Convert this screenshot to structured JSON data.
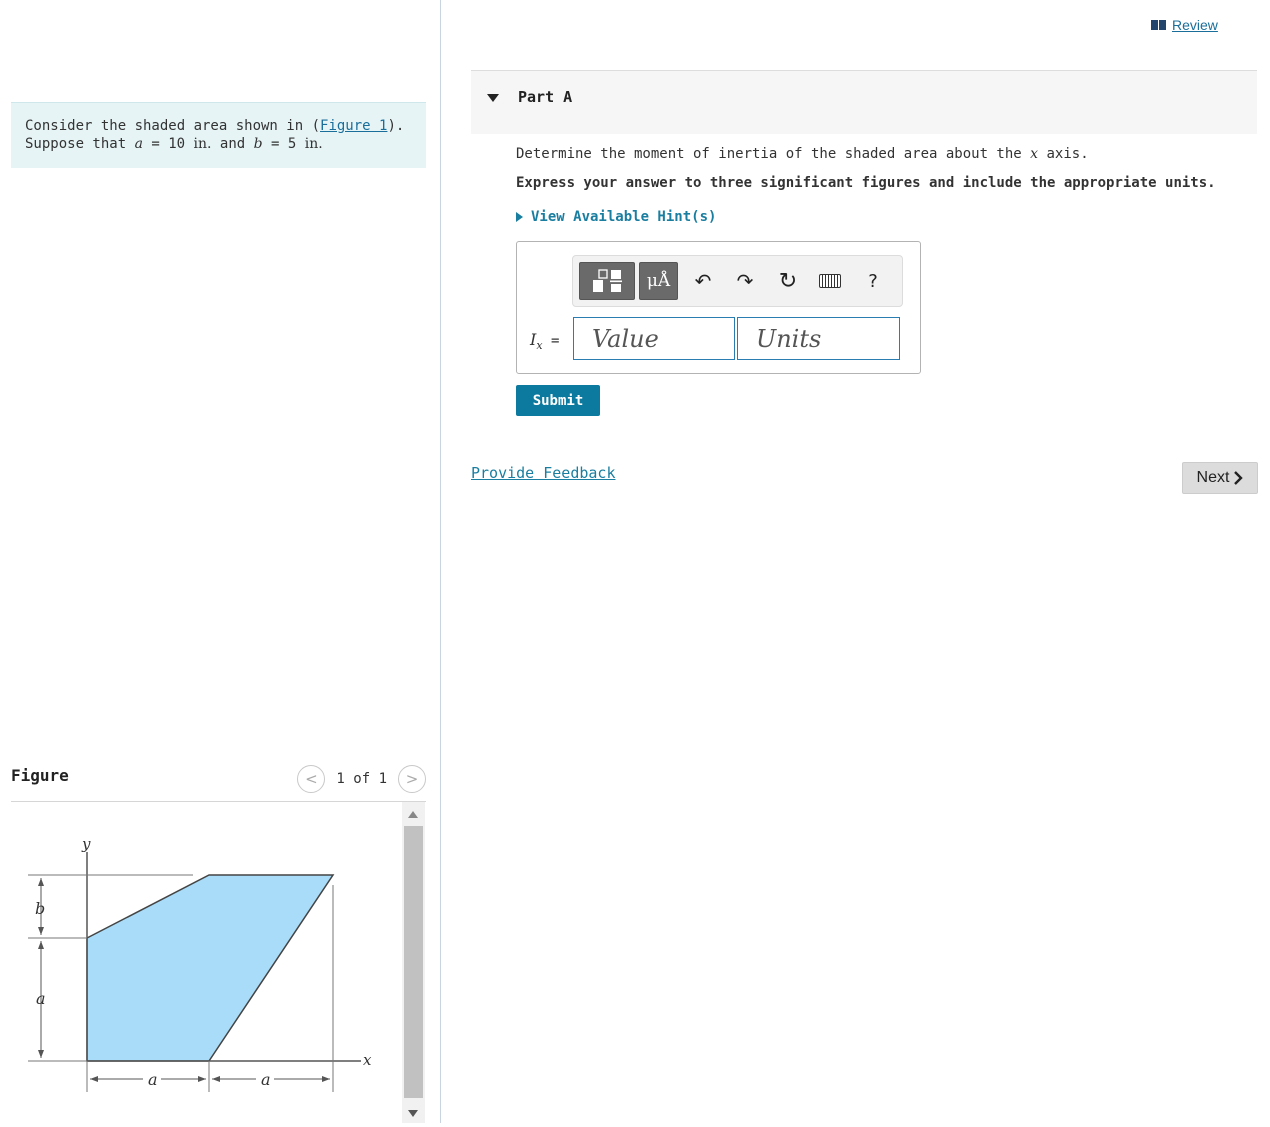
{
  "header": {
    "review_label": "Review"
  },
  "problem": {
    "line1_prefix": "Consider the shaded area shown in (",
    "figure_link": "Figure 1",
    "line1_suffix": ").",
    "line2_prefix": "Suppose that ",
    "var_a": "a",
    "equals1": " = 10 ",
    "unit1": "in.",
    "and": " and ",
    "var_b": "b",
    "equals2": " = 5 ",
    "unit2": "in."
  },
  "figure": {
    "title": "Figure",
    "pager_text": "1 of 1",
    "prev_glyph": "<",
    "next_glyph": ">",
    "labels": {
      "y": "y",
      "x": "x",
      "b": "b",
      "a_left": "a",
      "a_bottom1": "a",
      "a_bottom2": "a"
    },
    "fill_color": "#a8dcf8"
  },
  "part": {
    "title": "Part A",
    "question_prefix": "Determine the moment of inertia of the shaded area about the ",
    "question_var": "x",
    "question_suffix": " axis.",
    "instruction": "Express your answer to three significant figures and include the appropriate units.",
    "hint_label": "View Available Hint(s)"
  },
  "answer": {
    "units_button": "μÅ",
    "undo_glyph": "↶",
    "redo_glyph": "↷",
    "reset_glyph": "↻",
    "help_glyph": "?",
    "label_var": "I",
    "label_sub": "x",
    "label_eq": " =",
    "value_placeholder": "Value",
    "units_placeholder": "Units"
  },
  "actions": {
    "submit_label": "Submit",
    "feedback_label": "Provide Feedback",
    "next_label": "Next"
  },
  "colors": {
    "accent": "#0c7a9e",
    "link": "#1a7ea0",
    "problem_bg": "#e6f4f6"
  }
}
